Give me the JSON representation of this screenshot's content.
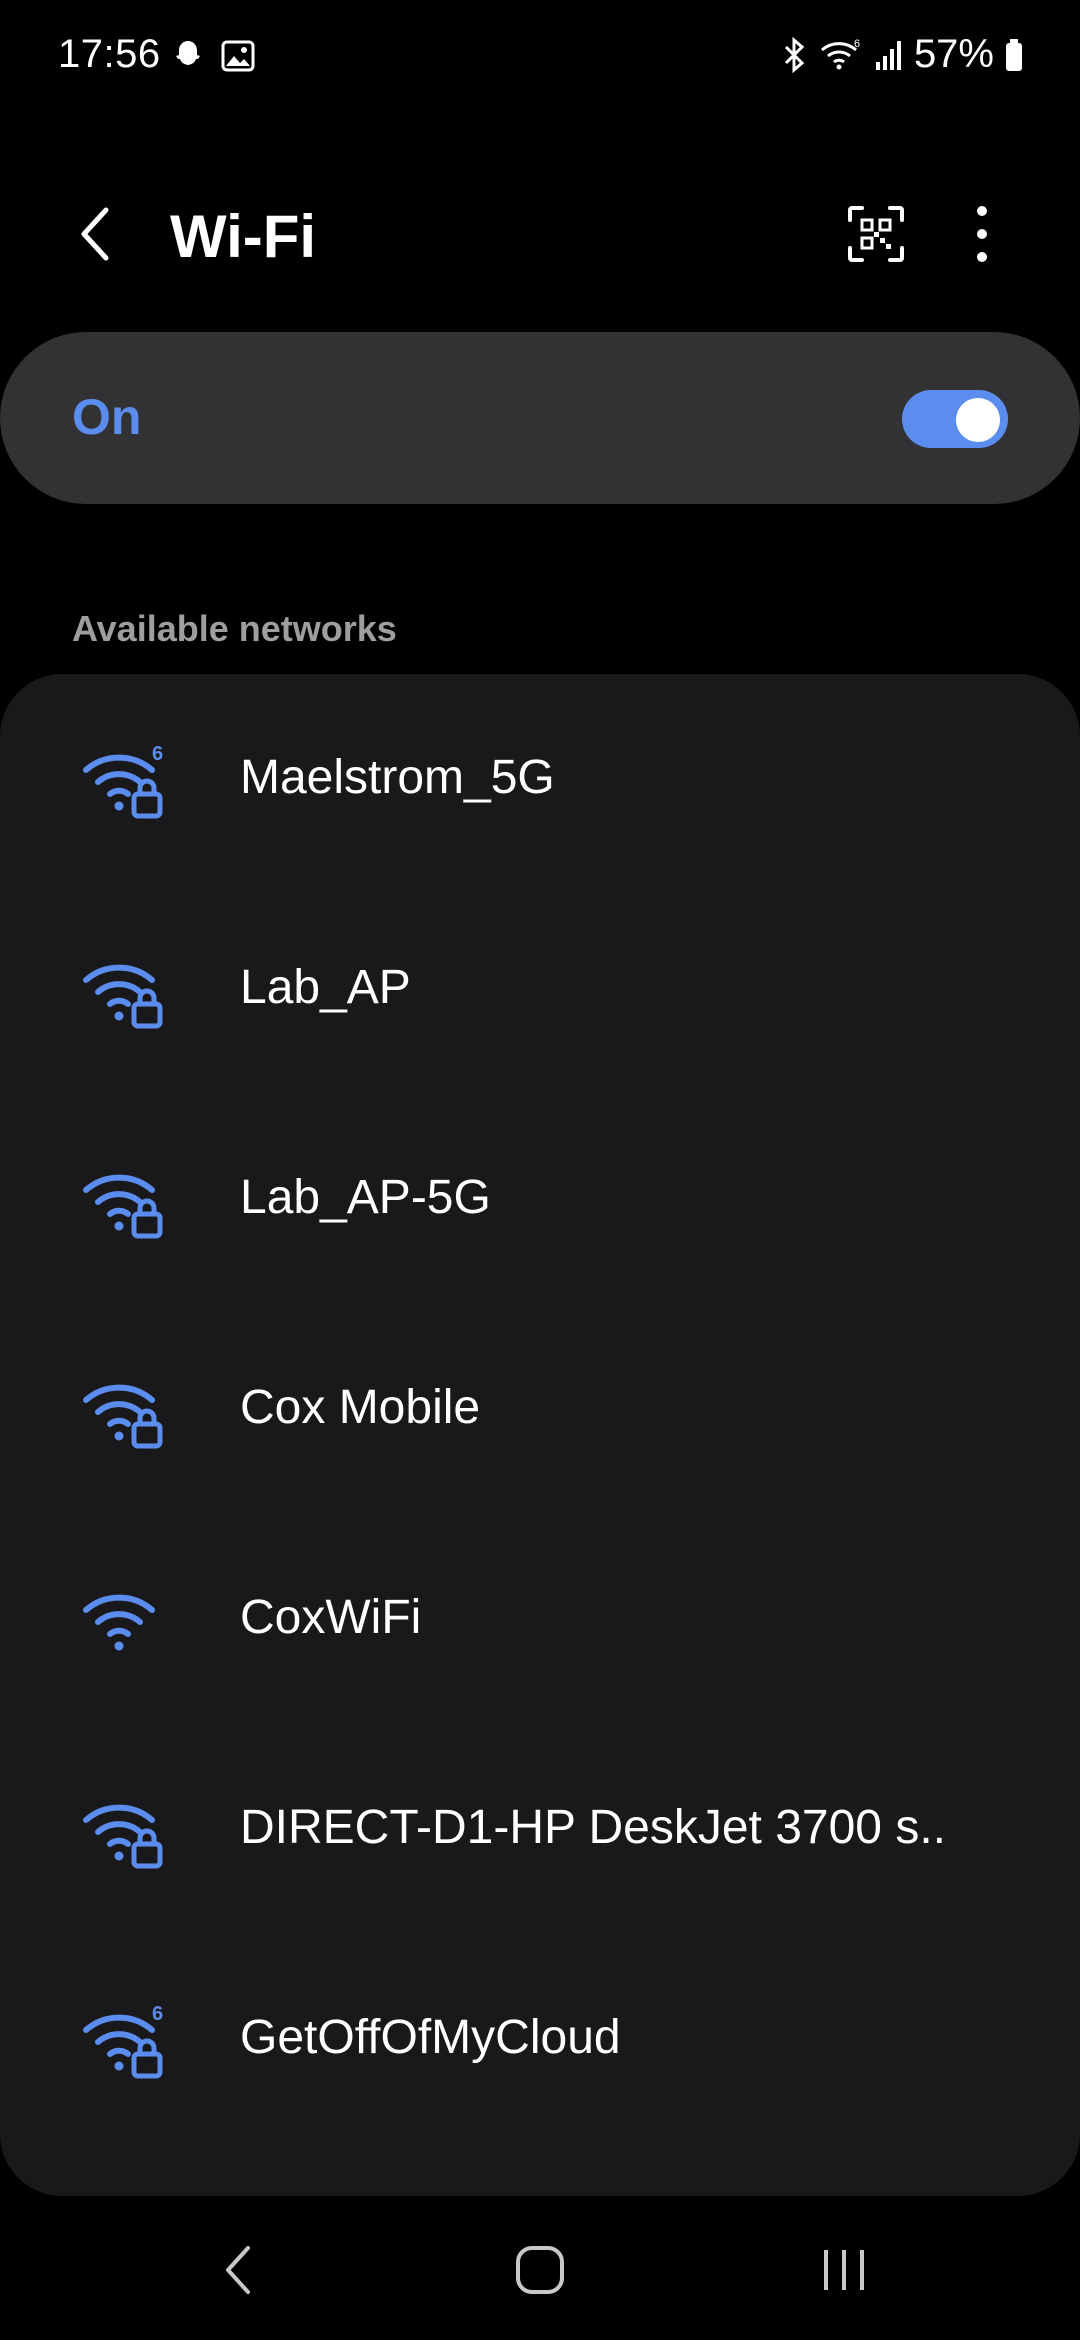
{
  "status_bar": {
    "time": "17:56",
    "left_icons": [
      "snapchat-icon",
      "image-icon"
    ],
    "right_icons": [
      "bluetooth-icon",
      "wifi-6-icon",
      "cellular-signal-icon",
      "battery-icon"
    ],
    "battery": "57%"
  },
  "header": {
    "title": "Wi-Fi",
    "back_icon": "back-arrow-icon",
    "qr_icon": "qr-scan-icon",
    "more_icon": "more-vert-icon"
  },
  "toggle": {
    "label": "On",
    "state": true
  },
  "section": {
    "title": "Available networks"
  },
  "networks": [
    {
      "name": "Maelstrom_5G",
      "wifi6": true,
      "locked": true
    },
    {
      "name": "Lab_AP",
      "wifi6": false,
      "locked": true
    },
    {
      "name": "Lab_AP-5G",
      "wifi6": false,
      "locked": true
    },
    {
      "name": "Cox Mobile",
      "wifi6": false,
      "locked": true
    },
    {
      "name": "CoxWiFi",
      "wifi6": false,
      "locked": false
    },
    {
      "name": "DIRECT-D1-HP DeskJet 3700 s..",
      "wifi6": false,
      "locked": true
    },
    {
      "name": "GetOffOfMyCloud",
      "wifi6": true,
      "locked": true
    }
  ],
  "nav": {
    "items": [
      "back-nav-icon",
      "home-nav-icon",
      "recents-nav-icon"
    ]
  },
  "colors": {
    "accent": "#5b8def",
    "background": "#000000",
    "card": "#19191b",
    "toggle_card": "#323234"
  }
}
